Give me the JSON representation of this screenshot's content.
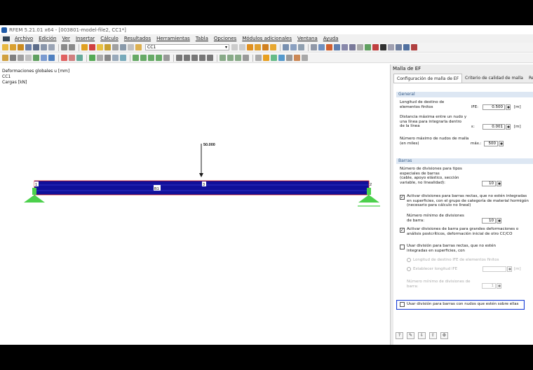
{
  "titlebar": {
    "text": "RFEM 5.21.01 x64 - [003801-model-file2, CC1*]"
  },
  "menu": [
    "Archivo",
    "Edición",
    "Ver",
    "Insertar",
    "Cálculo",
    "Resultados",
    "Herramientas",
    "Tabla",
    "Opciones",
    "Módulos adicionales",
    "Ventana",
    "Ayuda"
  ],
  "toolbar": {
    "loadcase": "CC1"
  },
  "viewport": {
    "info_lines": [
      "Deformaciones globales u [mm]",
      "CC1",
      "Cargas [kN]"
    ],
    "load_value": "50.000",
    "node_start": "1",
    "node_mid": "3",
    "node_end": "2",
    "member_label": "B1"
  },
  "panel": {
    "title": "Malla de EF",
    "tabs": [
      "Configuración de malla de EF",
      "Criterio de calidad de malla",
      "Refinam"
    ],
    "general": {
      "header": "General",
      "target_length_label": [
        "Longitud de destino de",
        "elementos finitos"
      ],
      "target_length_symbol": "lFE:",
      "target_length_value": "0.500",
      "target_length_unit": "[m]",
      "max_distance_label": [
        "Distancia máxima entre un nudo y",
        "una línea para integrarla dentro",
        "de la línea"
      ],
      "max_distance_symbol": "ε:",
      "max_distance_value": "0.001",
      "max_distance_unit": "[m]",
      "max_nodes_label": [
        "Número máximo de nudos de malla",
        "(en miles)"
      ],
      "max_nodes_symbol": "máx.:",
      "max_nodes_value": "500"
    },
    "barras": {
      "header": "Barras",
      "special_divisions_label": [
        "Número de divisiones para tipos",
        "especiales de barras",
        "(cable, apoyo elástico, sección",
        "variable, no linealidad):"
      ],
      "special_divisions_value": "10",
      "activate_straight_label": [
        "Activar divisiones para barras rectas, que no estén integradas",
        "en superficies, con el grupo de categoría de material hormigón",
        "(necesario para cálculo no lineal)"
      ],
      "activate_straight_checked": true,
      "min_divisions_label": [
        "Número mínimo de divisiones",
        "de barra:"
      ],
      "min_divisions_value": "10",
      "large_deform_label": [
        "Activar divisiones de barra para grandes deformaciones o",
        "análisis postcríticos, deformación inicial de otro CC/CO"
      ],
      "large_deform_checked": true,
      "surfaces_label": [
        "Usar división para barras rectas, que no estén",
        "integradas en superficies, con"
      ],
      "surfaces_checked": false,
      "radio_fe_length": "Longitud de destino lFE de elementos finitos",
      "radio_set_length": "Establecer longitud lFE",
      "set_length_unit": "[m]",
      "min_div_members_label": [
        "Número mínimo de divisiones de",
        "barra:"
      ],
      "min_div_members_value": "1",
      "nodes_on_members_label": "Usar división para barras con nudos que estén sobre ellas",
      "nodes_on_members_checked": false
    },
    "footer_icons": [
      "help-icon",
      "edit-icon",
      "import-icon",
      "export-icon",
      "settings-icon"
    ]
  },
  "colors": {
    "beam_fill": "#10109a",
    "beam_outline": "#d01010",
    "support_green": "#4cd04c",
    "highlight_border": "#1a3fd6",
    "group_header": "#dde7f3"
  }
}
